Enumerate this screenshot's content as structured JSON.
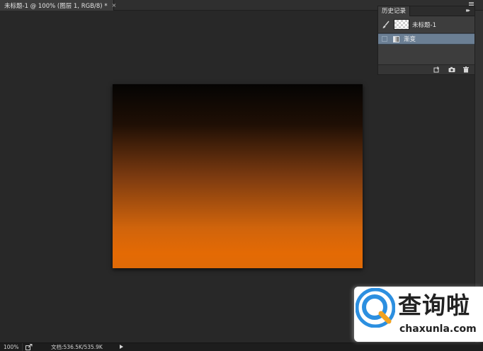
{
  "document": {
    "tab_title": "未标题-1 @ 100% (图层 1, RGB/8) *",
    "close_glyph": "×"
  },
  "history_panel": {
    "tab_label": "历史记录",
    "collapse_glyph": "▸▸",
    "snapshot": {
      "label": "未标题-1",
      "thumb_icon": "transparent-checker-thumbnail"
    },
    "states": [
      {
        "label": "渐变",
        "icon": "gradient-tool-icon",
        "selected": true
      }
    ],
    "footer_icons": [
      "new-document-from-state-icon",
      "camera-icon",
      "trash-icon"
    ]
  },
  "canvas": {
    "gradient_top": "#050403",
    "gradient_bottom": "#e06a07"
  },
  "status_bar": {
    "zoom": "100%",
    "doc_info": "文档:536.5K/535.9K"
  },
  "watermark": {
    "title": "查询啦",
    "url": "chaxunla.com",
    "colors": {
      "blue": "#2c8fe0",
      "orange": "#f2a21f"
    }
  },
  "colors": {
    "workspace": "#282828",
    "panel": "#3d3d3d",
    "selection": "#6b7f94"
  }
}
